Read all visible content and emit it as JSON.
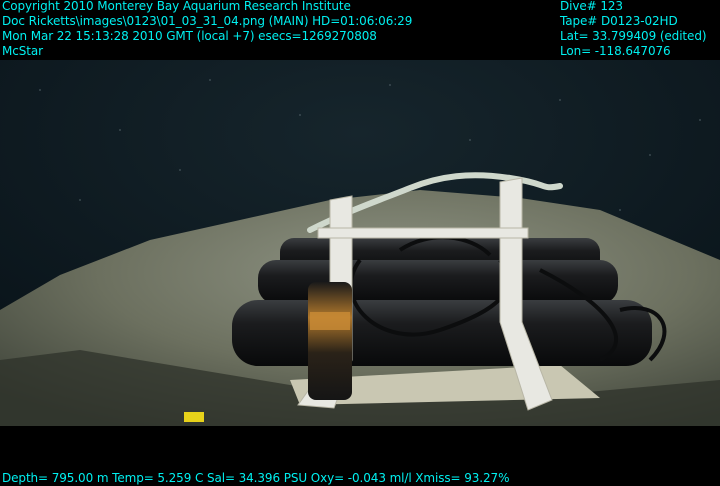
{
  "overlay": {
    "header_left": [
      "Copyright 2010 Monterey Bay Aquarium Research Institute",
      "Doc Ricketts\\images\\0123\\01_03_31_04.png (MAIN)  HD=01:06:06:29",
      "Mon Mar 22 15:13:28 2010 GMT (local +7)  esecs=1269270808",
      "McStar"
    ],
    "header_right": [
      "Dive# 123",
      "Tape# D0123-02HD",
      "Lat= 33.799409 (edited)",
      "Lon= -118.647076"
    ],
    "footer": "Depth= 795.00 m  Temp= 5.259 C  Sal= 34.396 PSU  Oxy= -0.043 ml/l  Xmiss= 93.27%"
  },
  "colors": {
    "overlay_text": "#00f0f0",
    "letterbox": "#000000",
    "water": "#0d1a22",
    "seafloor": "#6f7464",
    "instrument_body": "#121314",
    "frame_plastic": "#e8e8e2"
  }
}
